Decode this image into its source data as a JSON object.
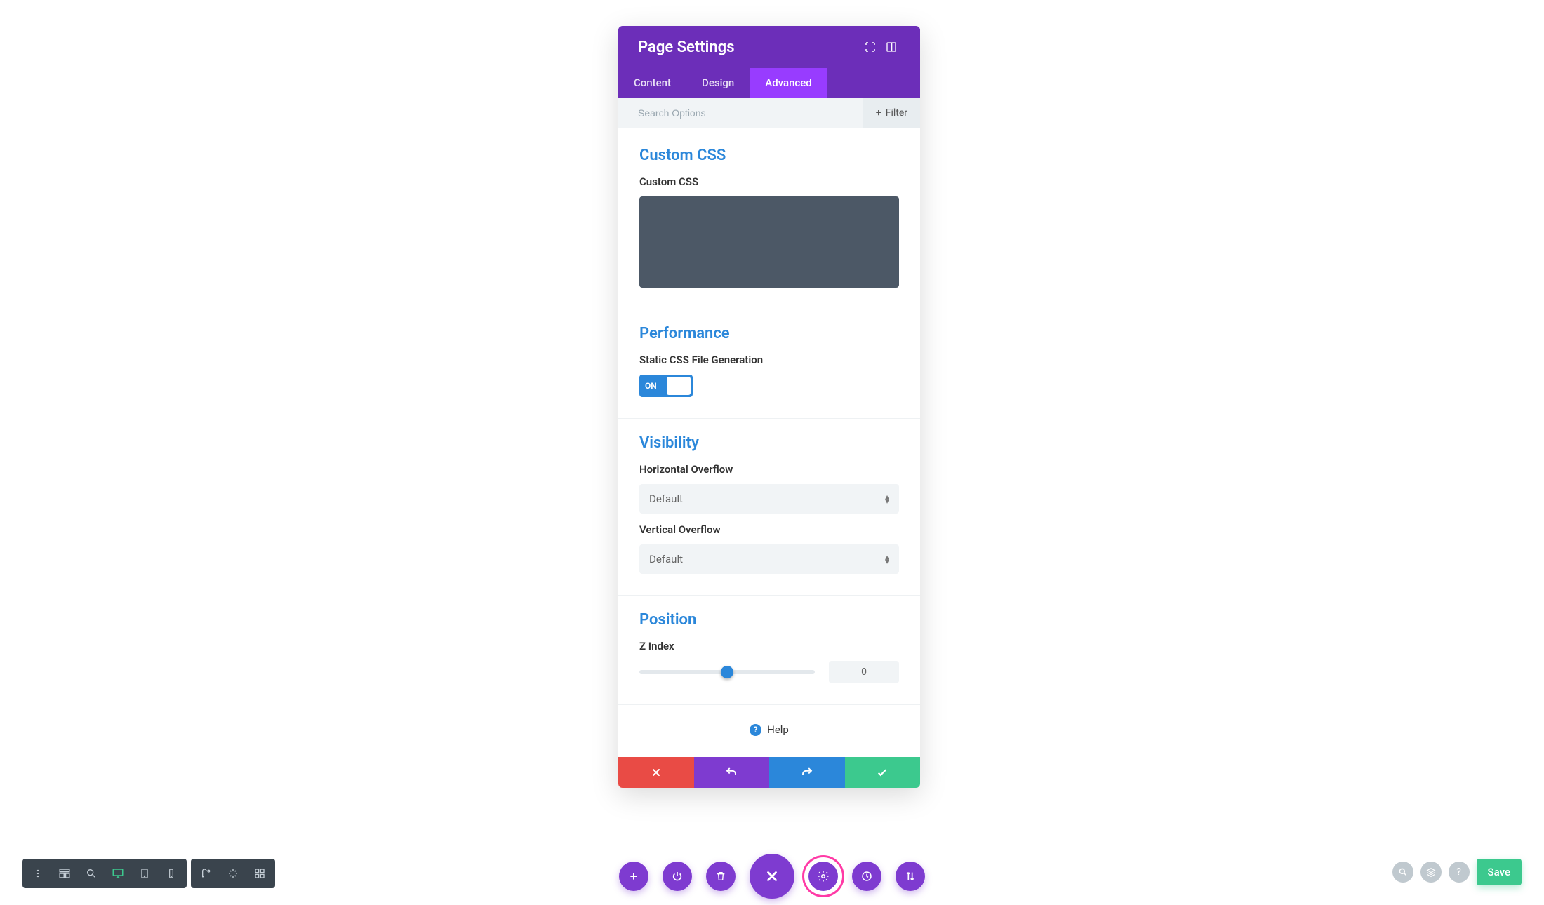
{
  "modal": {
    "title": "Page Settings",
    "tabs": {
      "content": "Content",
      "design": "Design",
      "advanced": "Advanced",
      "active": "advanced"
    },
    "search_placeholder": "Search Options",
    "filter_label": "Filter"
  },
  "sections": {
    "custom_css": {
      "heading": "Custom CSS",
      "field_label": "Custom CSS"
    },
    "performance": {
      "heading": "Performance",
      "field_label": "Static CSS File Generation",
      "toggle_state": "ON"
    },
    "visibility": {
      "heading": "Visibility",
      "h_overflow_label": "Horizontal Overflow",
      "h_overflow_value": "Default",
      "v_overflow_label": "Vertical Overflow",
      "v_overflow_value": "Default"
    },
    "position": {
      "heading": "Position",
      "zindex_label": "Z Index",
      "zindex_value": "0"
    }
  },
  "help_label": "Help",
  "save_label": "Save",
  "select_caret": "⇵"
}
